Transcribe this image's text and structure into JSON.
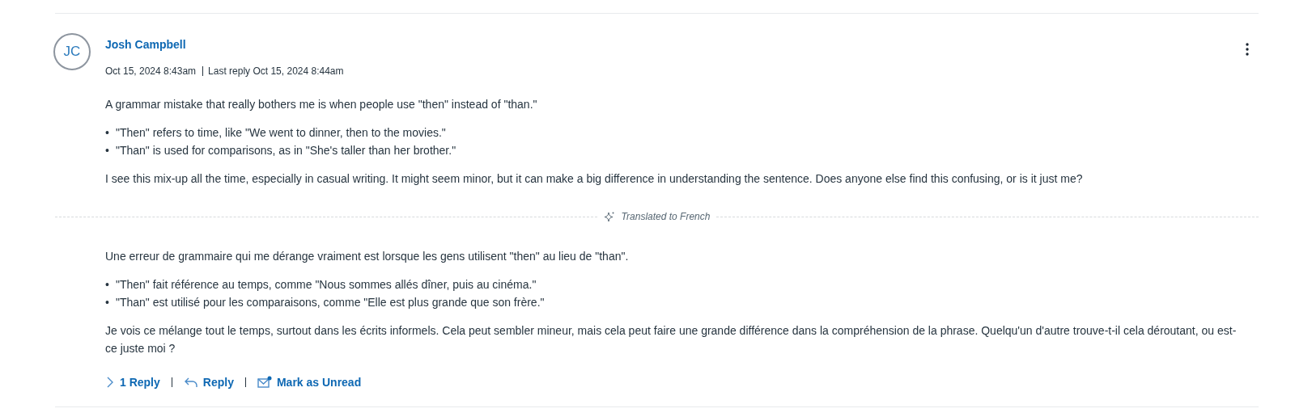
{
  "post": {
    "avatar": "JC",
    "author": "Josh Campbell",
    "posted": "Oct 15, 2024 8:43am",
    "last_reply": "Last reply Oct 15, 2024 8:44am",
    "original": {
      "intro": "A grammar mistake that really bothers me is when people use \"then\" instead of \"than.\"",
      "bullets": [
        {
          "marker": "•",
          "text": "\"Then\" refers to time, like \"We went to dinner, then to the movies.\""
        },
        {
          "marker": "•",
          "text": "\"Than\" is used for comparisons, as in \"She's taller than her brother.\""
        }
      ],
      "outro": "I see this mix-up all the time, especially in casual writing. It might seem minor, but it can make a big difference in understanding the sentence. Does anyone else find this confusing, or is it just me?"
    },
    "translation_label": "Translated to French",
    "translated": {
      "intro": "Une erreur de grammaire qui me dérange vraiment est lorsque les gens utilisent \"then\" au lieu de \"than\".",
      "bullets": [
        {
          "marker": "•",
          "text": "\"Then\" fait référence au temps, comme \"Nous sommes allés dîner, puis au cinéma.\""
        },
        {
          "marker": "•",
          "text": "\"Than\" est utilisé pour les comparaisons, comme \"Elle est plus grande que son frère.\""
        }
      ],
      "outro": "Je vois ce mélange tout le temps, surtout dans les écrits informels. Cela peut sembler mineur, mais cela peut faire une grande différence dans la compréhension de la phrase. Quelqu'un d'autre trouve-t-il cela déroutant, ou est-ce juste moi ?"
    },
    "actions": [
      {
        "kind": "expand",
        "label": "1 Reply",
        "expanded": false
      },
      {
        "kind": "reply",
        "label": "Reply"
      },
      {
        "kind": "unread",
        "label": "Mark as Unread"
      }
    ]
  }
}
